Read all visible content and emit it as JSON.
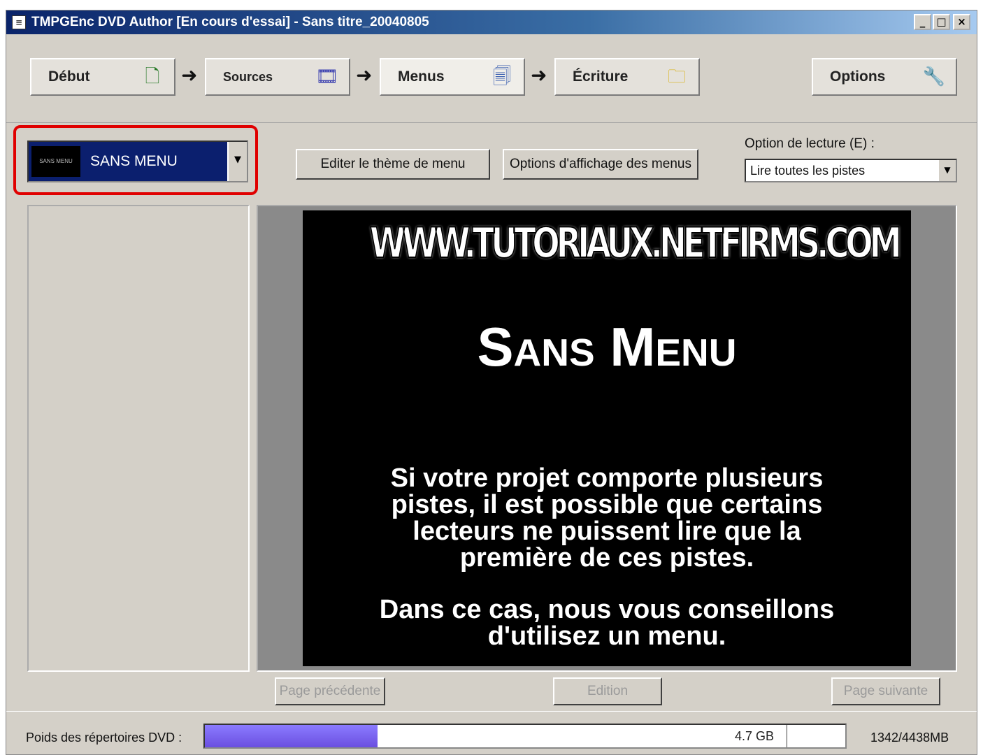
{
  "window": {
    "title": "TMPGEnc DVD Author [En cours d'essai] - Sans titre_20040805",
    "controls": {
      "minimize": "_",
      "maximize": "□",
      "close": "×"
    }
  },
  "wizard": {
    "steps": [
      {
        "label": "Début",
        "icon": "document-icon"
      },
      {
        "label": "Sources",
        "icon": "video-files-icon"
      },
      {
        "label": "Menus",
        "icon": "menu-pages-icon"
      },
      {
        "label": "Écriture",
        "icon": "folder-disc-icon"
      }
    ],
    "arrow": "➜",
    "options_label": "Options",
    "active_step": "Menus"
  },
  "menu_selector": {
    "value": "SANS MENU",
    "thumb_text": "SANS MENU"
  },
  "toolbar": {
    "edit_theme": "Editer le thème de menu",
    "display_options": "Options d'affichage des menus"
  },
  "playback": {
    "label": "Option de lecture (E) :",
    "value": "Lire toutes les pistes"
  },
  "preview": {
    "url": "WWW.TUTORIAUX.NETFIRMS.COM",
    "title": "Sans Menu",
    "message_lines": [
      "Si votre projet comporte plusieurs",
      "pistes, il est possible que certains",
      "lecteurs ne puissent lire que la",
      "première de ces pistes."
    ],
    "advice_lines": [
      "Dans ce cas, nous vous conseillons",
      "d'utilisez un menu."
    ]
  },
  "pager": {
    "previous": "Page précédente",
    "edit": "Edition",
    "next": "Page suivante"
  },
  "status": {
    "label": "Poids des répertoires DVD :",
    "capacity": "4.7 GB",
    "readout": "1342/4438MB",
    "used_fraction": 0.27,
    "fill_color": "#7a64f0"
  }
}
